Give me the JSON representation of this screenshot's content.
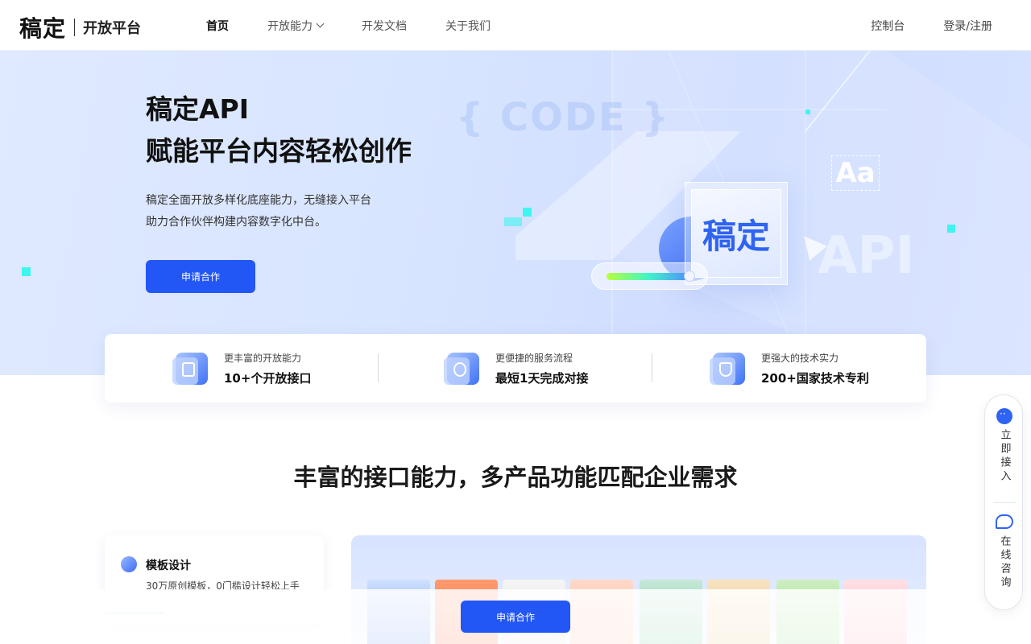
{
  "header": {
    "logo": "稿定",
    "logo_sub": "开放平台",
    "nav": [
      {
        "label": "首页"
      },
      {
        "label": "开放能力"
      },
      {
        "label": "开发文档"
      },
      {
        "label": "关于我们"
      }
    ],
    "console": "控制台",
    "login": "登录/注册"
  },
  "hero": {
    "title1": "稿定API",
    "title2": "赋能平台内容轻松创作",
    "desc1": "稿定全面开放多样化底座能力，无缝接入平台",
    "desc2": "助力合作伙伴构建内容数字化中台。",
    "cta": "申请合作",
    "code_text": "{ CODE }",
    "api_text": "API",
    "aa_text": "Aa",
    "cube_text": "稿定"
  },
  "stats": [
    {
      "small": "更丰富的开放能力",
      "big": "10+个开放接口",
      "icon": "document-icon"
    },
    {
      "small": "更便捷的服务流程",
      "big": "最短1天完成对接",
      "icon": "user-icon"
    },
    {
      "small": "更强大的技术实力",
      "big": "200+国家技术专利",
      "icon": "shield-icon"
    }
  ],
  "section": {
    "title": "丰富的接口能力，多产品功能匹配企业需求"
  },
  "feature": {
    "title": "模板设计",
    "desc": "30万原创模板，0门槛设计轻松上手"
  },
  "bottom": {
    "cta": "申请合作"
  },
  "side": {
    "access": "立即接入",
    "consult": "在线咨询"
  },
  "colors": {
    "primary": "#2256f5",
    "accent_cyan": "#3ff5ef"
  }
}
